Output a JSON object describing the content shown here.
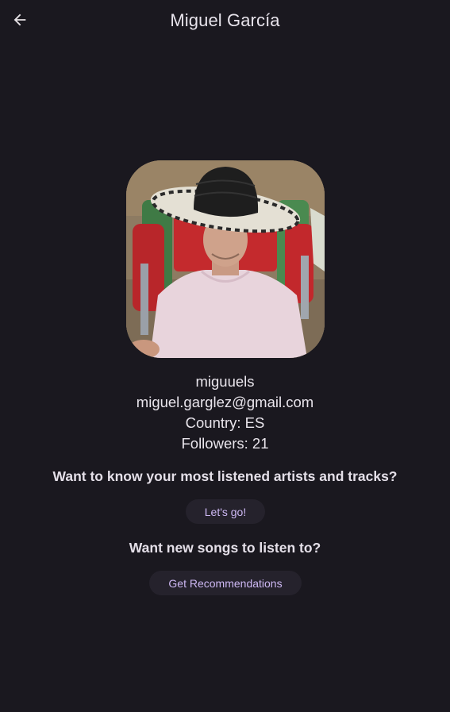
{
  "header": {
    "title": "Miguel García",
    "back_icon": "arrow-left-icon"
  },
  "profile": {
    "avatar_alt": "profile photo",
    "username": "miguuels",
    "email": "miguel.garglez@gmail.com",
    "country": "Country: ES",
    "followers": "Followers: 21"
  },
  "sections": {
    "top_question": "Want to know your most listened artists and tracks?",
    "top_button": "Let's go!",
    "rec_question": "Want new songs to listen to?",
    "rec_button": "Get Recommendations"
  },
  "colors": {
    "background": "#1a181f",
    "button_bg": "#25222c",
    "button_text": "#cdb8f3",
    "text": "#e6e1e5"
  }
}
